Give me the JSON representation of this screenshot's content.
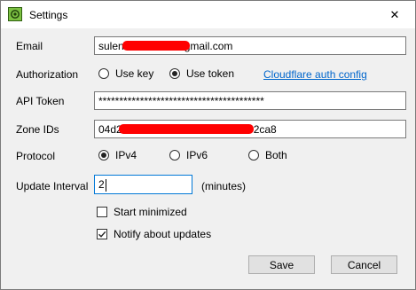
{
  "window": {
    "title": "Settings",
    "close_symbol": "✕"
  },
  "fields": {
    "email": {
      "label": "Email",
      "value_prefix": "sulen",
      "value_suffix": "gmail.com"
    },
    "authorization": {
      "label": "Authorization",
      "options": [
        "Use key",
        "Use token"
      ],
      "selected": "Use token",
      "link": "Cloudflare auth config"
    },
    "api_token": {
      "label": "API Token",
      "value": "****************************************"
    },
    "zone_ids": {
      "label": "Zone IDs",
      "value_prefix": "04d2",
      "value_suffix": "2ca8"
    },
    "protocol": {
      "label": "Protocol",
      "options": [
        "IPv4",
        "IPv6",
        "Both"
      ],
      "selected": "IPv4"
    },
    "update_interval": {
      "label": "Update Interval",
      "value": "2",
      "unit": "(minutes)"
    }
  },
  "options": {
    "start_minimized": {
      "label": "Start minimized",
      "checked": false
    },
    "notify_updates": {
      "label": "Notify about updates",
      "checked": true
    }
  },
  "buttons": {
    "save": "Save",
    "cancel": "Cancel"
  },
  "colors": {
    "redaction": "#ff0000",
    "link": "#0066cc",
    "accent": "#4a8a1a"
  }
}
